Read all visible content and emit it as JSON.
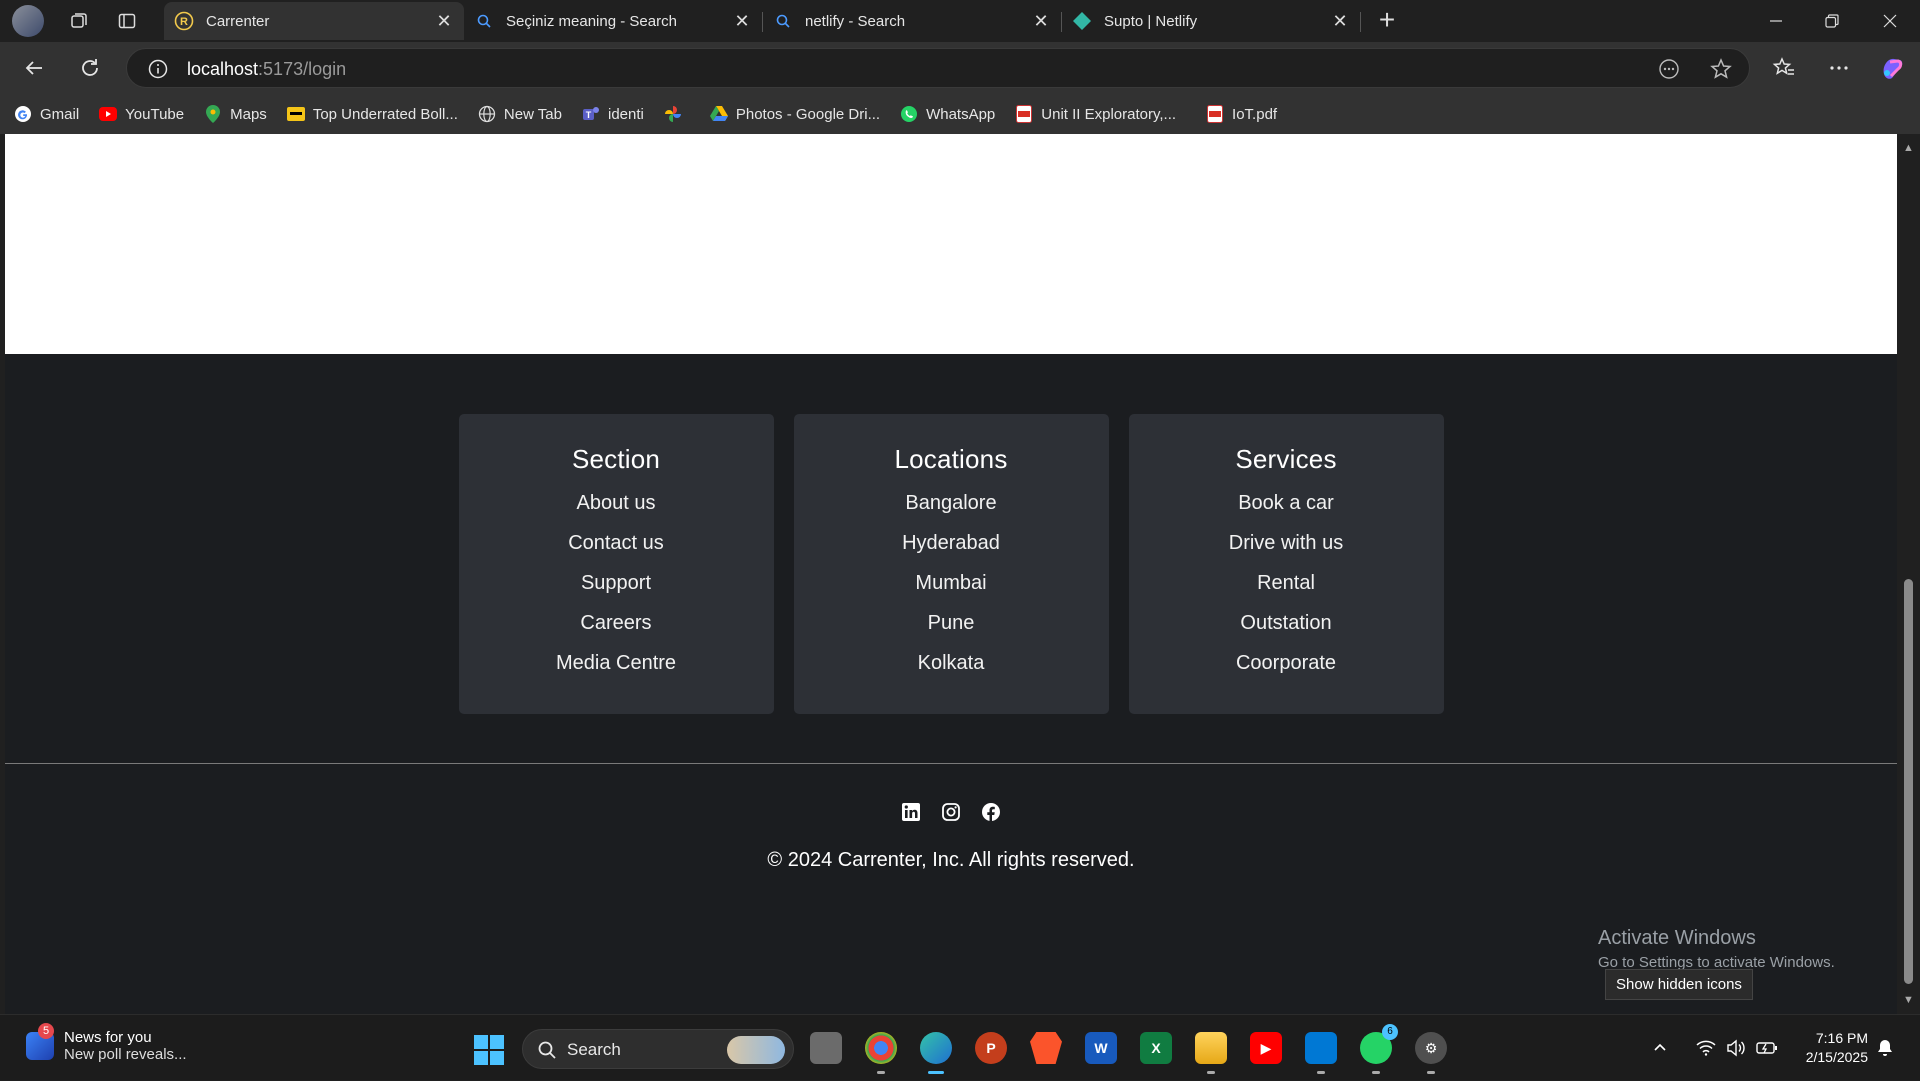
{
  "browser": {
    "tabs": [
      {
        "title": "Carrenter",
        "active": true,
        "favicon": "carrenter-r-icon"
      },
      {
        "title": "Seçiniz meaning - Search",
        "active": false,
        "favicon": "search-icon"
      },
      {
        "title": "netlify - Search",
        "active": false,
        "favicon": "search-icon"
      },
      {
        "title": "Supto | Netlify",
        "active": false,
        "favicon": "netlify-icon"
      }
    ],
    "url_host": "localhost",
    "url_path": ":5173/login",
    "bookmarks": [
      {
        "label": "Gmail",
        "icon": "gmail-icon"
      },
      {
        "label": "YouTube",
        "icon": "youtube-icon"
      },
      {
        "label": "Maps",
        "icon": "maps-icon"
      },
      {
        "label": "Top Underrated Boll...",
        "icon": "imdb-icon"
      },
      {
        "label": "New Tab",
        "icon": "globe-icon"
      },
      {
        "label": "identi",
        "icon": "teams-icon"
      },
      {
        "label": "",
        "icon": "pinwheel-icon"
      },
      {
        "label": "Photos - Google Dri...",
        "icon": "drive-icon"
      },
      {
        "label": "WhatsApp",
        "icon": "whatsapp-icon"
      },
      {
        "label": "Unit II Exploratory,...",
        "icon": "pdf-icon"
      },
      {
        "label": "IoT.pdf",
        "icon": "pdf-icon"
      }
    ]
  },
  "footer": {
    "columns": [
      {
        "heading": "Section",
        "links": [
          "About us",
          "Contact us",
          "Support",
          "Careers",
          "Media Centre"
        ]
      },
      {
        "heading": "Locations",
        "links": [
          "Bangalore",
          "Hyderabad",
          "Mumbai",
          "Pune",
          "Kolkata"
        ]
      },
      {
        "heading": "Services",
        "links": [
          "Book a car",
          "Drive with us",
          "Rental",
          "Outstation",
          "Coorporate"
        ]
      }
    ],
    "social": [
      "linkedin-icon",
      "instagram-icon",
      "facebook-icon"
    ],
    "copyright": "© 2024 Carrenter, Inc. All rights reserved."
  },
  "watermark": {
    "title": "Activate Windows",
    "subtitle": "Go to Settings to activate Windows."
  },
  "tooltip": "Show hidden icons",
  "taskbar": {
    "news_title": "News for you",
    "news_subtitle": "New poll reveals...",
    "news_badge": "5",
    "search_label": "Search",
    "whatsapp_badge": "6",
    "time": "7:16 PM",
    "date": "2/15/2025"
  },
  "colors": {
    "page_bg": "#1b1d20",
    "card_bg": "#2d3036",
    "accent": "#4cc2ff"
  }
}
